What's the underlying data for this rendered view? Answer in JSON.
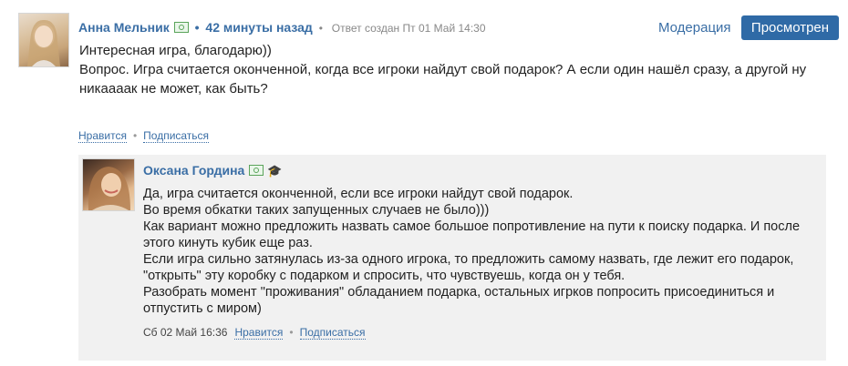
{
  "comment": {
    "author": "Анна Мельник",
    "time_ago": "42 минуты назад",
    "created": "Ответ создан Пт 01 Май 14:30",
    "moderation_label": "Модерация",
    "viewed_label": "Просмотрен",
    "lines": [
      "Интересная игра, благодарю))",
      "Вопрос. Игра считается оконченной, когда все игроки найдут свой подарок? А если один нашёл сразу, а другой ну никаааак не может, как быть?"
    ],
    "like_label": "Нравится",
    "subscribe_label": "Подписаться"
  },
  "reply": {
    "author": "Оксана Гордина",
    "lines": [
      "Да, игра считается оконченной, если все игроки найдут свой подарок.",
      "Во время обкатки таких запущенных случаев не было)))",
      "Как вариант можно предложить назвать самое большое попротивление на пути к поиску подарка. И после этого кинуть кубик еще раз.",
      "Если игра сильно затянулась из-за одного игрока, то предложить самому назвать, где лежит его подарок, \"открыть\" эту коробку с подарком и спросить, что чувствуешь, когда он у тебя.",
      "Разобрать момент \"проживания\" обладанием подарка, остальных игрков попросить присоединиться и отпустить с миром)"
    ],
    "date": "Сб 02 Май 16:36",
    "like_label": "Нравится",
    "subscribe_label": "Подписаться"
  },
  "icons": {
    "money_badge": "money-badge-icon",
    "graduate": "graduation-cap-icon"
  }
}
